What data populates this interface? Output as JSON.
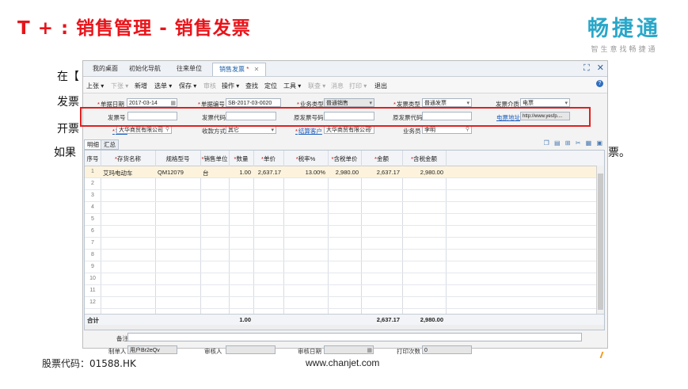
{
  "slide": {
    "title": "T + : 销售管理 - 销售发票",
    "logo_text": "畅捷通",
    "logo_sub": "智生意找畅捷通",
    "bg_lines": [
      "在【",
      "发票",
      "开票",
      "如果",
      "票。"
    ],
    "stock_code": "股票代码：01588.HK",
    "website": "www.chanjet.com"
  },
  "app": {
    "tabs": [
      "我的桌面",
      "初始化导航",
      "往来单位",
      "销售发票"
    ],
    "active_tab_marker": "*",
    "toolbar": [
      "上张 ▾",
      "下张 ▾",
      "新增",
      "选单 ▾",
      "保存 ▾",
      "审核",
      "操作 ▾",
      "查找",
      "定位",
      "工具 ▾",
      "联查 ▾",
      "消息",
      "打印 ▾",
      "退出"
    ],
    "header": {
      "doc_date_label": "单据日期",
      "doc_date": "2017-03-14",
      "doc_no_label": "单据编号",
      "doc_no": "SB-2017-03-0020",
      "biz_type_label": "业务类型",
      "biz_type": "普通销售",
      "inv_type_label": "发票类型",
      "inv_type": "普通发票",
      "inv_medium_label": "发票介质",
      "inv_medium": "电票",
      "inv_no_label": "发票号",
      "inv_no": "",
      "inv_code_label": "发票代码",
      "inv_code": "",
      "orig_inv_no_label": "原发票号码",
      "orig_inv_no": "",
      "orig_inv_code_label": "原发票代码",
      "orig_inv_code": "",
      "e_inv_addr_label": "电票地址",
      "e_inv_addr": "http://www.yesfp....",
      "customer_label": "客户",
      "customer": "大华商贸有限公司",
      "pay_method_label": "收款方式",
      "pay_method": "其它",
      "settle_customer_label": "结算客户",
      "settle_customer": "大华商贸有限公司",
      "salesman_label": "业务员",
      "salesman": "李明"
    },
    "subtabs": [
      "明细",
      "汇总"
    ],
    "grid": {
      "columns": [
        "序号",
        "存货名称",
        "规格型号",
        "销售单位",
        "数量",
        "单价",
        "税率%",
        "含税单价",
        "金额",
        "含税金额"
      ],
      "rows": [
        {
          "no": "1",
          "name": "艾玛电动车",
          "spec": "QM12079",
          "unit": "台",
          "qty": "1.00",
          "price": "2,637.17",
          "tax": "13.00%",
          "tax_price": "2,980.00",
          "amount": "2,637.17",
          "tax_amount": "2,980.00"
        }
      ],
      "row_numbers": [
        "2",
        "3",
        "4",
        "5",
        "6",
        "7",
        "8",
        "9",
        "10",
        "11",
        "12"
      ],
      "total_label": "合计",
      "total_qty": "1.00",
      "total_amount": "2,637.17",
      "total_tax_amount": "2,980.00"
    },
    "footer": {
      "remark_label": "备注",
      "remark": "",
      "maker_label": "制单人",
      "maker": "用户Br2eQv",
      "auditor_label": "审核人",
      "auditor": "",
      "audit_date_label": "审核日期",
      "audit_date": "",
      "print_count_label": "打印次数",
      "print_count": "0"
    }
  }
}
